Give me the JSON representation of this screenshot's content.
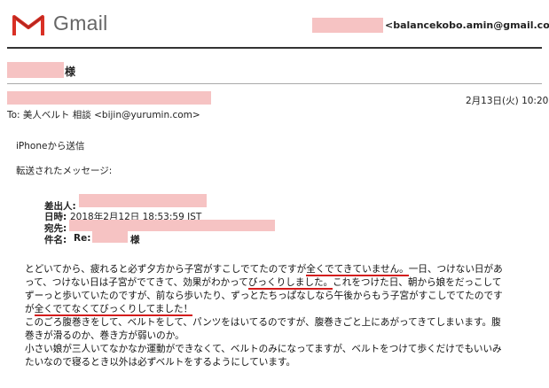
{
  "brand": {
    "name": "Gmail",
    "accent": "#d93025"
  },
  "sender_email": "<balancekobo.amin@gmail.com>",
  "header": {
    "recipient_suffix": "様",
    "date": "2月13日(火) 10:20",
    "to_line": "To: 美人ベルト 相談 <bijin@yurumin.com>"
  },
  "body": {
    "sent_from": "iPhoneから送信",
    "forwarded_label": "転送されたメッセージ:",
    "fwd": {
      "from_label": "差出人:",
      "date_label": "日時:",
      "date_value": "2018年2月12日 18:53:59 JST",
      "to_label": "宛先:",
      "subject_label": "件名:",
      "subject_prefix": "Re:",
      "subject_suffix": "様"
    },
    "message": {
      "l1a": "とどいてから、疲れると必ず夕方から子宮がすこしでてたのですが",
      "l1b": "全くでてきていません。",
      "l1c": "一日、つけない日があ",
      "l2a": "って、つけない日は子宮がでてきて、効果がわかって",
      "l2b": "びっくりしました。",
      "l2c": "これをつけた日、朝から娘をだっこして",
      "l3": "ずーっと歩いていたのですが、前なら歩いたり、ずっとたちっぱなしなら午後からもう子宮がすこしでてたのです",
      "l4a": "が",
      "l4b": "全くでてなくてびっくりしてました！",
      "l5": "このごろ腹巻きをして、ベルトをして、パンツをはいてるのですが、腹巻きごと上にあがってきてしまいます。腹",
      "l6": "巻きが滑るのか、巻き方が弱いのか。",
      "l7": "小さい娘が三人いてなかなか運動ができなくて、ベルトのみになってますが、ベルトをつけて歩くだけでもいいみ",
      "l8": "たいなので寝るとき以外は必ずベルトをするようにしています。"
    }
  }
}
